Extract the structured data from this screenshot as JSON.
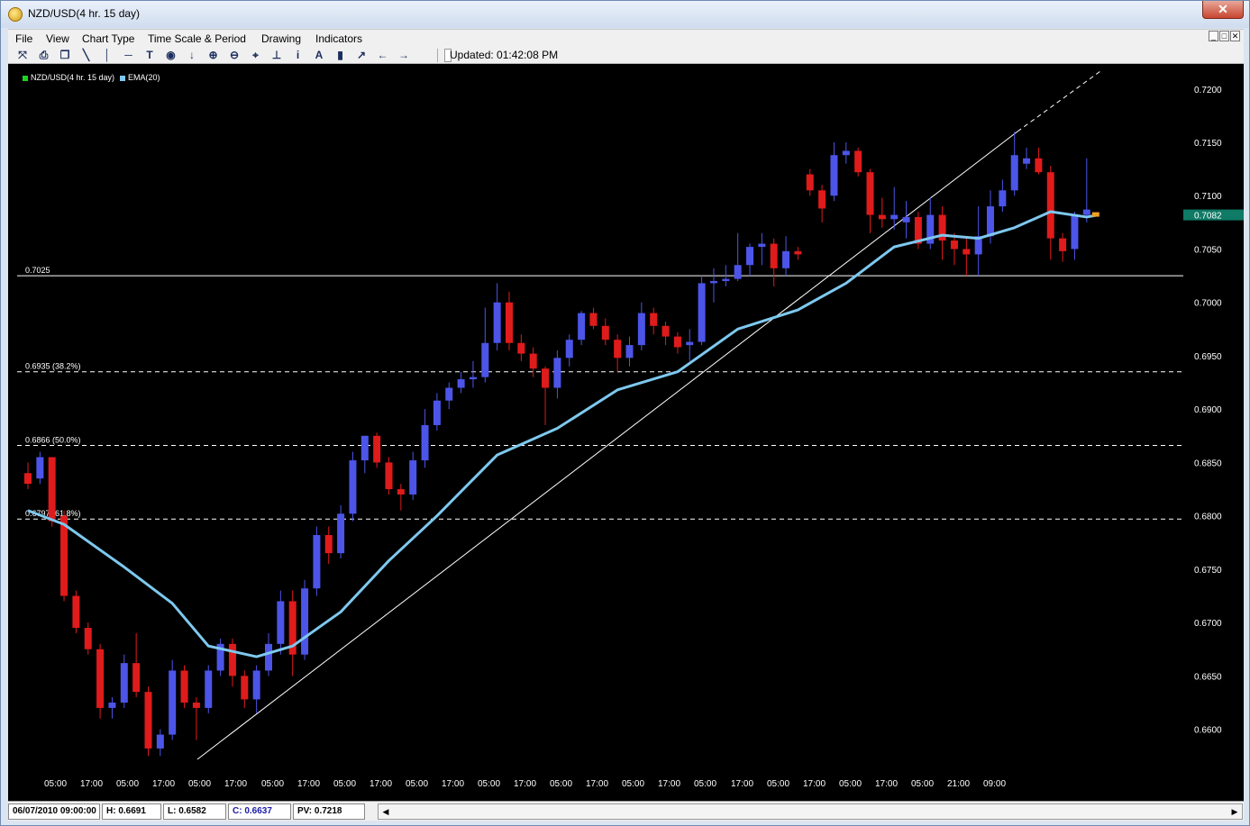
{
  "window": {
    "title": "NZD/USD(4 hr.  15 day)",
    "close_label": "✕"
  },
  "menu": {
    "items": [
      "File",
      "View",
      "Chart Type",
      "Time Scale & Period",
      "Drawing",
      "Indicators"
    ],
    "mdi_buttons": [
      "_",
      "□",
      "✕"
    ]
  },
  "toolbar": {
    "icons": [
      "pointer-icon",
      "print-icon",
      "copy-icon",
      "trendline-icon",
      "vertical-line-icon",
      "horizontal-line-icon",
      "text-icon",
      "circle-icon",
      "down-arrow-icon",
      "zoom-in-icon",
      "zoom-out-icon",
      "fit-icon",
      "baseline-icon",
      "info-icon",
      "font-icon",
      "bar-chart-icon",
      "line-chart-icon",
      "scroll-left-icon",
      "scroll-right-icon"
    ],
    "glyphs": [
      "⤧",
      "⎙",
      "❐",
      "╲",
      "│",
      "─",
      "T",
      "◉",
      "↓",
      "⊕",
      "⊖",
      "⌖",
      "⊥",
      "i",
      "A",
      "▮",
      "↗",
      "←",
      "→"
    ],
    "updated_text": "Updated: 01:42:08 PM"
  },
  "chart_data": {
    "type": "candlestick",
    "legend": [
      {
        "name": "NZD/USD(4 hr.  15 day)",
        "color": "#1fd21f"
      },
      {
        "name": "EMA(20)",
        "color": "#7ec8ee"
      }
    ],
    "colors": {
      "up": "#4c55e8",
      "down": "#e01b1b",
      "ema": "#7ec8ee",
      "background": "#000000",
      "grid_lines": "#ffffff"
    },
    "ylim": [
      0.656,
      0.7215
    ],
    "y_ticks": [
      "0.7200",
      "0.7150",
      "0.7100",
      "0.7050",
      "0.7000",
      "0.6950",
      "0.6900",
      "0.6850",
      "0.6800",
      "0.6750",
      "0.6700",
      "0.6650",
      "0.6600"
    ],
    "x_ticks": [
      "05:00",
      "17:00",
      "05:00",
      "17:00",
      "05:00",
      "17:00",
      "05:00",
      "17:00",
      "05:00",
      "17:00",
      "05:00",
      "17:00",
      "05:00",
      "17:00",
      "05:00",
      "17:00",
      "05:00",
      "17:00",
      "05:00",
      "17:00",
      "05:00",
      "17:00",
      "05:00",
      "17:00",
      "05:00",
      "21:00",
      "09:00"
    ],
    "last_price_label": "0.7082",
    "horizontal_lines": [
      {
        "value": 0.7025,
        "label": "0.7025",
        "style": "solid"
      },
      {
        "value": 0.6935,
        "label": "0.6935 (38.2%)",
        "style": "dashed"
      },
      {
        "value": 0.6866,
        "label": "0.6866 (50.0%)",
        "style": "dashed"
      },
      {
        "value": 0.6797,
        "label": "0.6797 (61.8%)",
        "style": "dashed"
      }
    ],
    "candles": [
      [
        0.684,
        0.685,
        0.6825,
        0.683
      ],
      [
        0.6835,
        0.686,
        0.683,
        0.6855
      ],
      [
        0.6855,
        0.6855,
        0.679,
        0.6795
      ],
      [
        0.68,
        0.6805,
        0.672,
        0.6725
      ],
      [
        0.6725,
        0.673,
        0.669,
        0.6695
      ],
      [
        0.6695,
        0.67,
        0.667,
        0.6675
      ],
      [
        0.6675,
        0.668,
        0.661,
        0.662
      ],
      [
        0.662,
        0.663,
        0.661,
        0.6625
      ],
      [
        0.6625,
        0.667,
        0.662,
        0.6662
      ],
      [
        0.6662,
        0.669,
        0.663,
        0.6635
      ],
      [
        0.6635,
        0.664,
        0.6575,
        0.6582
      ],
      [
        0.6582,
        0.66,
        0.6575,
        0.6595
      ],
      [
        0.6595,
        0.6665,
        0.659,
        0.6655
      ],
      [
        0.6655,
        0.666,
        0.662,
        0.6625
      ],
      [
        0.6625,
        0.663,
        0.659,
        0.662
      ],
      [
        0.662,
        0.666,
        0.6615,
        0.6655
      ],
      [
        0.6655,
        0.6685,
        0.665,
        0.668
      ],
      [
        0.668,
        0.6685,
        0.664,
        0.665
      ],
      [
        0.665,
        0.6655,
        0.662,
        0.6628
      ],
      [
        0.6628,
        0.666,
        0.6615,
        0.6655
      ],
      [
        0.6655,
        0.669,
        0.665,
        0.668
      ],
      [
        0.668,
        0.673,
        0.667,
        0.672
      ],
      [
        0.672,
        0.673,
        0.665,
        0.667
      ],
      [
        0.667,
        0.674,
        0.6665,
        0.6732
      ],
      [
        0.6732,
        0.679,
        0.6725,
        0.6782
      ],
      [
        0.6782,
        0.679,
        0.6755,
        0.6765
      ],
      [
        0.6765,
        0.681,
        0.676,
        0.6802
      ],
      [
        0.6802,
        0.686,
        0.6795,
        0.6852
      ],
      [
        0.6852,
        0.6875,
        0.684,
        0.6875
      ],
      [
        0.6875,
        0.6878,
        0.6845,
        0.685
      ],
      [
        0.685,
        0.6855,
        0.682,
        0.6825
      ],
      [
        0.6825,
        0.683,
        0.6805,
        0.682
      ],
      [
        0.682,
        0.686,
        0.6815,
        0.6852
      ],
      [
        0.6852,
        0.69,
        0.6845,
        0.6885
      ],
      [
        0.6885,
        0.6915,
        0.688,
        0.6908
      ],
      [
        0.6908,
        0.6925,
        0.69,
        0.692
      ],
      [
        0.692,
        0.6935,
        0.6915,
        0.6928
      ],
      [
        0.6928,
        0.6945,
        0.692,
        0.693
      ],
      [
        0.693,
        0.6995,
        0.6925,
        0.6962
      ],
      [
        0.6962,
        0.7018,
        0.6955,
        0.7
      ],
      [
        0.7,
        0.701,
        0.6955,
        0.6962
      ],
      [
        0.6962,
        0.697,
        0.6945,
        0.6952
      ],
      [
        0.6952,
        0.6958,
        0.693,
        0.6938
      ],
      [
        0.6938,
        0.694,
        0.6885,
        0.692
      ],
      [
        0.692,
        0.6955,
        0.691,
        0.6948
      ],
      [
        0.6948,
        0.697,
        0.694,
        0.6965
      ],
      [
        0.6965,
        0.6992,
        0.696,
        0.699
      ],
      [
        0.699,
        0.6995,
        0.6975,
        0.6978
      ],
      [
        0.6978,
        0.6985,
        0.696,
        0.6965
      ],
      [
        0.6965,
        0.697,
        0.6935,
        0.6948
      ],
      [
        0.6948,
        0.6968,
        0.694,
        0.696
      ],
      [
        0.696,
        0.7,
        0.6955,
        0.699
      ],
      [
        0.699,
        0.6995,
        0.697,
        0.6978
      ],
      [
        0.6978,
        0.6982,
        0.696,
        0.6968
      ],
      [
        0.6968,
        0.6972,
        0.6952,
        0.6958
      ],
      [
        0.696,
        0.6975,
        0.6945,
        0.6963
      ],
      [
        0.6963,
        0.7025,
        0.696,
        0.7018
      ],
      [
        0.7018,
        0.7032,
        0.7,
        0.702
      ],
      [
        0.702,
        0.7035,
        0.7015,
        0.7022
      ],
      [
        0.7022,
        0.7065,
        0.702,
        0.7035
      ],
      [
        0.7035,
        0.7055,
        0.7025,
        0.7052
      ],
      [
        0.7052,
        0.7065,
        0.7035,
        0.7055
      ],
      [
        0.7055,
        0.706,
        0.7015,
        0.7032
      ],
      [
        0.7032,
        0.7062,
        0.7025,
        0.7048
      ],
      [
        0.7048,
        0.7052,
        0.704,
        0.7045
      ],
      [
        0.712,
        0.7125,
        0.71,
        0.7105
      ],
      [
        0.7105,
        0.711,
        0.7075,
        0.7088
      ],
      [
        0.71,
        0.715,
        0.7095,
        0.7138
      ],
      [
        0.7138,
        0.715,
        0.713,
        0.7142
      ],
      [
        0.7142,
        0.7145,
        0.7118,
        0.7122
      ],
      [
        0.7122,
        0.7125,
        0.7065,
        0.7082
      ],
      [
        0.7082,
        0.7098,
        0.707,
        0.7078
      ],
      [
        0.7078,
        0.7108,
        0.7068,
        0.7082
      ],
      [
        0.7075,
        0.7095,
        0.706,
        0.708
      ],
      [
        0.708,
        0.7085,
        0.705,
        0.7055
      ],
      [
        0.7055,
        0.7098,
        0.705,
        0.7082
      ],
      [
        0.7082,
        0.709,
        0.704,
        0.7058
      ],
      [
        0.7058,
        0.7065,
        0.7035,
        0.705
      ],
      [
        0.705,
        0.706,
        0.7025,
        0.7045
      ],
      [
        0.7045,
        0.709,
        0.7025,
        0.7062
      ],
      [
        0.7062,
        0.7105,
        0.7055,
        0.709
      ],
      [
        0.709,
        0.7115,
        0.7085,
        0.7105
      ],
      [
        0.7105,
        0.716,
        0.71,
        0.7138
      ],
      [
        0.713,
        0.7145,
        0.7125,
        0.7135
      ],
      [
        0.7135,
        0.7145,
        0.712,
        0.7122
      ],
      [
        0.7122,
        0.7128,
        0.704,
        0.706
      ],
      [
        0.706,
        0.7065,
        0.7038,
        0.7048
      ],
      [
        0.705,
        0.7085,
        0.704,
        0.7082
      ],
      [
        0.7082,
        0.7135,
        0.7075,
        0.7087
      ]
    ],
    "ema_points": [
      [
        0,
        0.6805
      ],
      [
        3,
        0.6792
      ],
      [
        8,
        0.6752
      ],
      [
        12,
        0.6718
      ],
      [
        15,
        0.6678
      ],
      [
        19,
        0.6668
      ],
      [
        22,
        0.6678
      ],
      [
        26,
        0.671
      ],
      [
        30,
        0.6758
      ],
      [
        34,
        0.68
      ],
      [
        39,
        0.6857
      ],
      [
        44,
        0.6882
      ],
      [
        49,
        0.6918
      ],
      [
        54,
        0.6935
      ],
      [
        59,
        0.6975
      ],
      [
        64,
        0.6993
      ],
      [
        68,
        0.7018
      ],
      [
        72,
        0.7052
      ],
      [
        76,
        0.7063
      ],
      [
        79,
        0.706
      ],
      [
        82,
        0.707
      ],
      [
        85,
        0.7085
      ],
      [
        88,
        0.708
      ],
      [
        89,
        0.7082
      ]
    ]
  },
  "status_bar": {
    "date": "06/07/2010 09:00:00",
    "high": "H: 0.6691",
    "low": "L: 0.6582",
    "close": "C: 0.6637",
    "pv": "PV: 0.7218",
    "scroll_left": "◀",
    "scroll_right": "▶"
  }
}
